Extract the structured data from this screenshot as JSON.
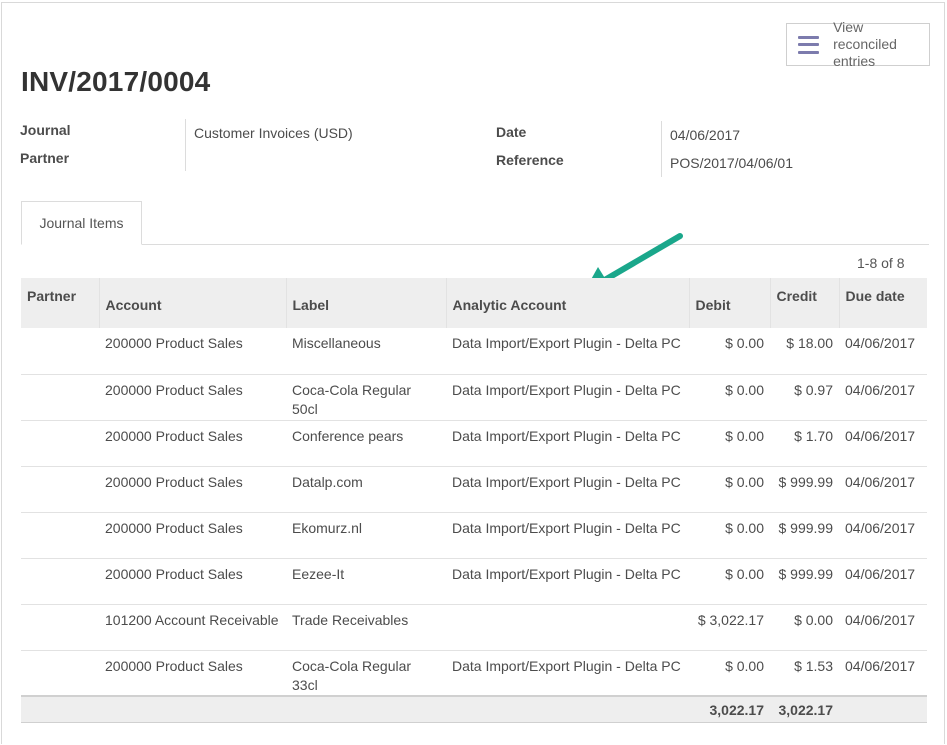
{
  "toolbar": {
    "view_reconciled_label": "View reconciled entries",
    "view_reconciled_icon": "list-icon"
  },
  "record": {
    "title": "INV/2017/0004",
    "journal_label": "Journal",
    "journal_value": "Customer Invoices (USD)",
    "partner_label": "Partner",
    "partner_value": "",
    "date_label": "Date",
    "date_value": "04/06/2017",
    "reference_label": "Reference",
    "reference_value": "POS/2017/04/06/01"
  },
  "tabs": [
    {
      "label": "Journal Items",
      "active": true
    }
  ],
  "pager": "1-8 of 8",
  "annotation": {
    "arrow_color": "#1aa78b"
  },
  "table": {
    "columns": [
      "Partner",
      "Account",
      "Label",
      "Analytic Account",
      "Debit",
      "Credit",
      "Due date"
    ],
    "rows": [
      [
        "",
        "200000 Product Sales",
        "Miscellaneous",
        "Data Import/Export Plugin - Delta PC",
        "$ 0.00",
        "$ 18.00",
        "04/06/2017"
      ],
      [
        "",
        "200000 Product Sales",
        "Coca-Cola Regular 50cl",
        "Data Import/Export Plugin - Delta PC",
        "$ 0.00",
        "$ 0.97",
        "04/06/2017"
      ],
      [
        "",
        "200000 Product Sales",
        "Conference pears",
        "Data Import/Export Plugin - Delta PC",
        "$ 0.00",
        "$ 1.70",
        "04/06/2017"
      ],
      [
        "",
        "200000 Product Sales",
        "Datalp.com",
        "Data Import/Export Plugin - Delta PC",
        "$ 0.00",
        "$ 999.99",
        "04/06/2017"
      ],
      [
        "",
        "200000 Product Sales",
        "Ekomurz.nl",
        "Data Import/Export Plugin - Delta PC",
        "$ 0.00",
        "$ 999.99",
        "04/06/2017"
      ],
      [
        "",
        "200000 Product Sales",
        "Eezee-It",
        "Data Import/Export Plugin - Delta PC",
        "$ 0.00",
        "$ 999.99",
        "04/06/2017"
      ],
      [
        "",
        "101200 Account Receivable",
        "Trade Receivables",
        "",
        "$ 3,022.17",
        "$ 0.00",
        "04/06/2017"
      ],
      [
        "",
        "200000 Product Sales",
        "Coca-Cola Regular 33cl",
        "Data Import/Export Plugin - Delta PC",
        "$ 0.00",
        "$ 1.53",
        "04/06/2017"
      ]
    ],
    "totals": {
      "debit": "3,022.17",
      "credit": "3,022.17"
    }
  }
}
